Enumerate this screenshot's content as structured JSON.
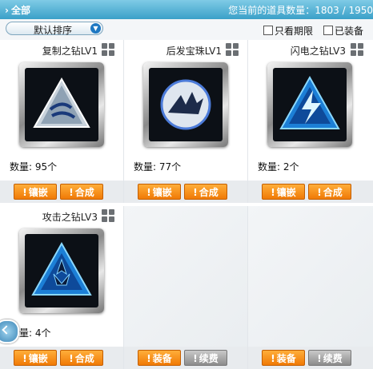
{
  "header": {
    "category": "全部",
    "item_count_label": "您当前的道具数量：1803 / 1950"
  },
  "filters": {
    "sort_label": "默认排序",
    "only_expiry_label": "只看期限",
    "equipped_label": "已装备"
  },
  "items": [
    {
      "name": "复制之钻LV1",
      "quantity": "数量: 95个",
      "btn1": "镶嵌",
      "btn2": "合成"
    },
    {
      "name": "后发宝珠LV1",
      "quantity": "数量: 77个",
      "btn1": "镶嵌",
      "btn2": "合成"
    },
    {
      "name": "闪电之钻LV3",
      "quantity": "数量: 2个",
      "btn1": "镶嵌",
      "btn2": "合成"
    },
    {
      "name": "攻击之钻LV3",
      "quantity": "数量: 4个",
      "btn1": "镶嵌",
      "btn2": "合成"
    }
  ],
  "empty_slots": [
    {
      "btn1": "装备",
      "btn2": "续费"
    },
    {
      "btn1": "装备",
      "btn2": "续费"
    }
  ],
  "colors": {
    "header_bg": "#3aa0c8",
    "button_orange": "#f07a06",
    "button_gray": "#8c8c8c"
  }
}
